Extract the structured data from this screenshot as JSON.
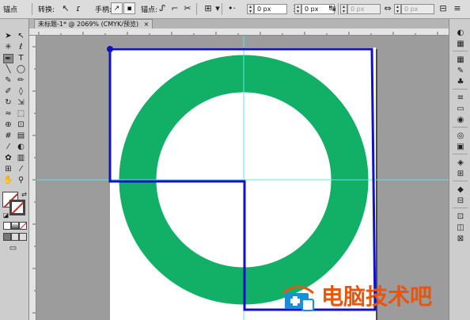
{
  "control_bar": {
    "anchor_label": "锚点",
    "convert_label": "转换:",
    "handles_label": "手柄:",
    "anchors_label": "锚点:",
    "x_value": "0 px",
    "y_value": "0 px",
    "w_value": "0 px",
    "h_value": "0 px"
  },
  "document_tab": {
    "title": "未标题-1* @ 2069% (CMYK/预览)",
    "close_glyph": "×"
  },
  "watermark": {
    "text": "电脑技术吧"
  },
  "colors": {
    "ring": "#12b066",
    "path_stroke": "#1010cc",
    "guide": "#64e0e6",
    "watermark_text": "#e8550c",
    "watermark_icon": "#1a8fd6"
  },
  "icons": {
    "selection": "selection-tool-icon",
    "direct_selection": "direct-selection-tool-icon",
    "pen": "pen-tool-icon",
    "type": "type-tool-icon",
    "hand": "hand-tool-icon",
    "zoom": "zoom-tool-icon"
  }
}
